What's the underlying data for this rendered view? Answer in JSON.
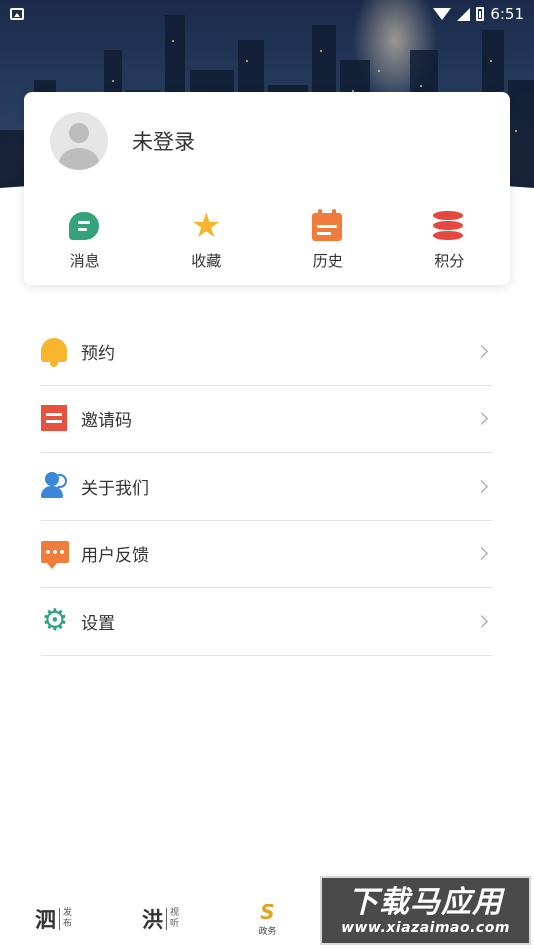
{
  "status_bar": {
    "time": "6:51",
    "icons": [
      "notification-icon",
      "wifi-icon",
      "signal-icon",
      "battery-icon"
    ]
  },
  "profile": {
    "login_text": "未登录",
    "avatar_icon": "default-avatar-icon"
  },
  "quick_actions": [
    {
      "label": "消息",
      "icon": "message-icon",
      "color": "#34a37b"
    },
    {
      "label": "收藏",
      "icon": "star-icon",
      "color": "#f6b52d"
    },
    {
      "label": "历史",
      "icon": "history-calendar-icon",
      "color": "#f07b3a"
    },
    {
      "label": "积分",
      "icon": "points-database-icon",
      "color": "#e5483f"
    }
  ],
  "menu": [
    {
      "label": "预约",
      "icon": "bell-icon",
      "color": "#f6b52d"
    },
    {
      "label": "邀请码",
      "icon": "invite-code-icon",
      "color": "#e8503f"
    },
    {
      "label": "关于我们",
      "icon": "about-user-icon",
      "color": "#3b86d9"
    },
    {
      "label": "用户反馈",
      "icon": "feedback-icon",
      "color": "#f07b3a"
    },
    {
      "label": "设置",
      "icon": "gear-icon",
      "color": "#34a37b"
    }
  ],
  "bottom_nav": [
    {
      "big": "泗",
      "small_1": "发",
      "small_2": "布"
    },
    {
      "big": "洪",
      "small_1": "视",
      "small_2": "听"
    },
    {
      "logo": "S",
      "label": "政务"
    }
  ],
  "watermark": {
    "title": "下载马应用",
    "url": "www.xiazaimao.com"
  }
}
